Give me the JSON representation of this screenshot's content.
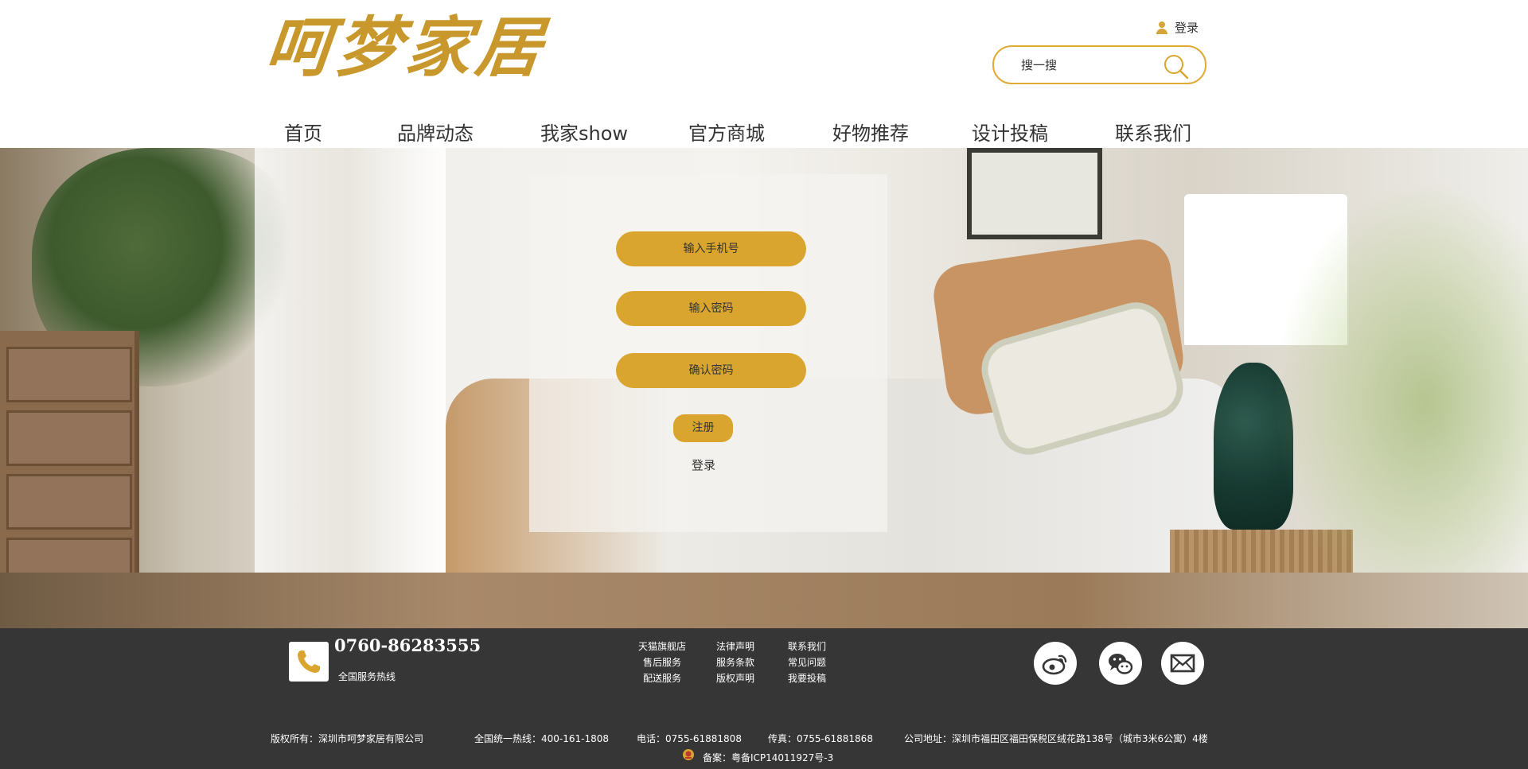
{
  "header": {
    "logo_text": "呵梦家居",
    "login_label": "登录",
    "search_placeholder": "搜一搜"
  },
  "nav": {
    "items": [
      "首页",
      "品牌动态",
      "我家show",
      "官方商城",
      "好物推荐",
      "设计投稿",
      "联系我们"
    ]
  },
  "register_form": {
    "phone_placeholder": "输入手机号",
    "password_placeholder": "输入密码",
    "confirm_placeholder": "确认密码",
    "register_label": "注册",
    "login_label": "登录"
  },
  "footer": {
    "hotline_number": "0760-86283555",
    "hotline_label": "全国服务热线",
    "links": [
      [
        "天猫旗舰店",
        "售后服务",
        "配送服务"
      ],
      [
        "法律声明",
        "服务条款",
        "版权声明"
      ],
      [
        "联系我们",
        "常见问题",
        "我要投稿"
      ]
    ],
    "social_icons": [
      "weibo-icon",
      "wechat-icon",
      "mail-icon"
    ],
    "copyright": "版权所有：深圳市呵梦家居有限公司",
    "national_hotline": "全国统一热线：400-161-1808",
    "phone": "电话：0755-61881808",
    "fax": "传真：0755-61881868",
    "address": "公司地址：深圳市福田区福田保税区绒花路138号（城市3米6公寓）4楼",
    "icp": "备案：粤备ICP14011927号-3"
  },
  "colors": {
    "accent": "#d9a52f",
    "logo": "#c9982d",
    "footer_bg": "#363636"
  }
}
